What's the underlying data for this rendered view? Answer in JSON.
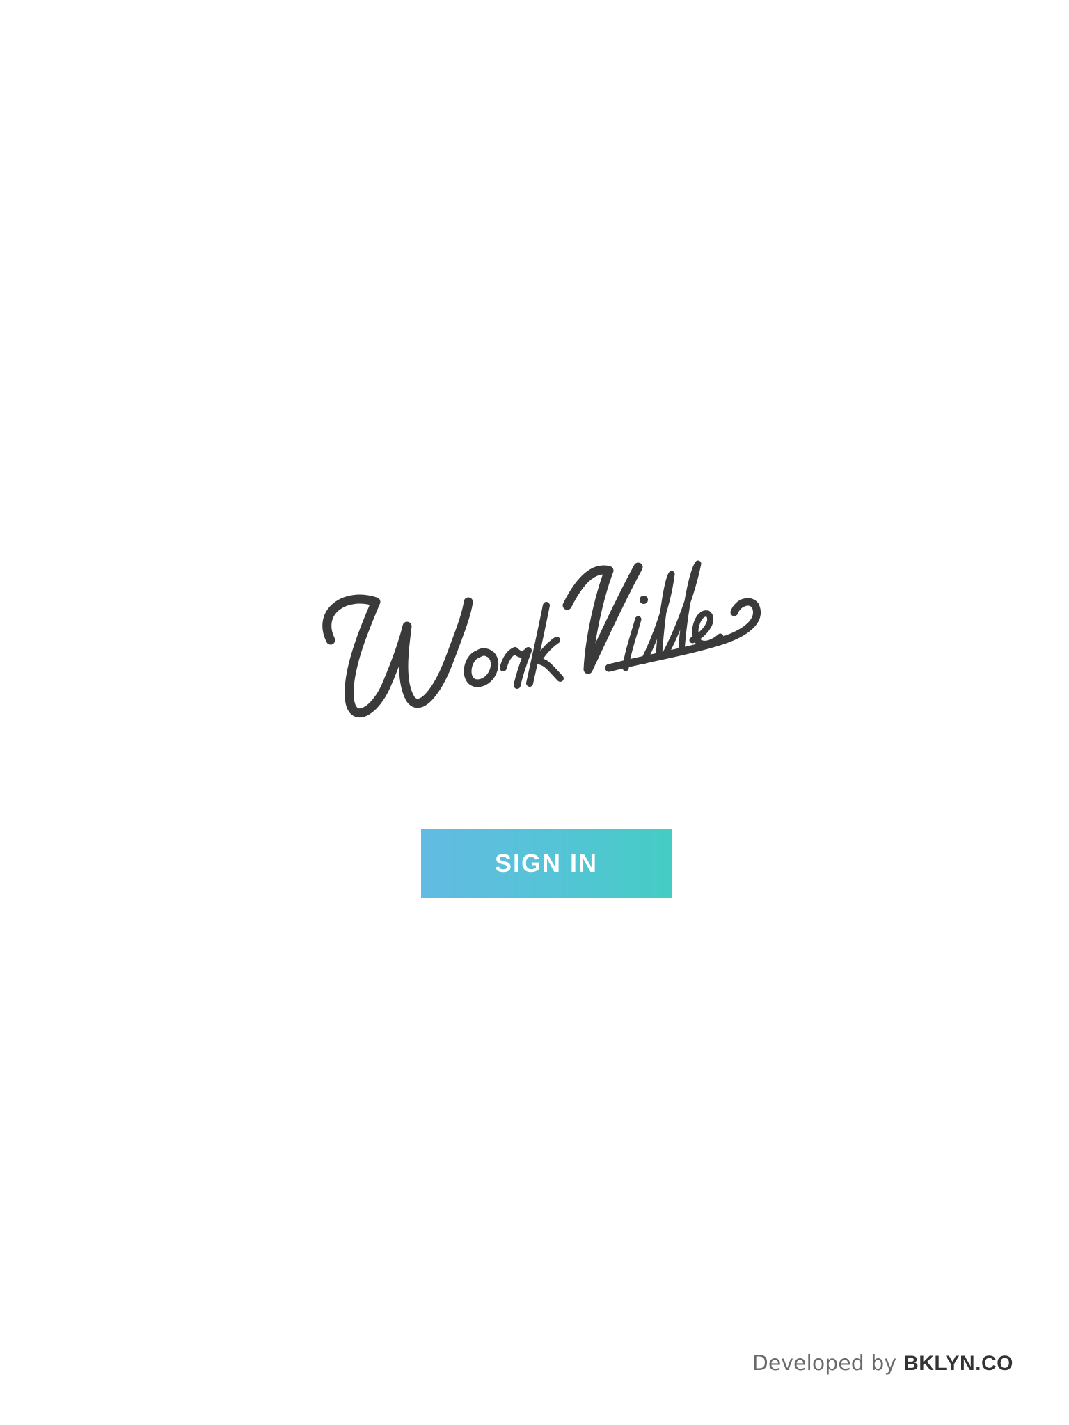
{
  "app": {
    "logo_text": "WorkVille",
    "logo_color": "#3a3a3a"
  },
  "signin": {
    "label": "SIGN IN",
    "gradient_start": "#62bbe2",
    "gradient_end": "#45cdc4"
  },
  "footer": {
    "prefix": "Developed by",
    "brand": "BKLYN.CO"
  }
}
